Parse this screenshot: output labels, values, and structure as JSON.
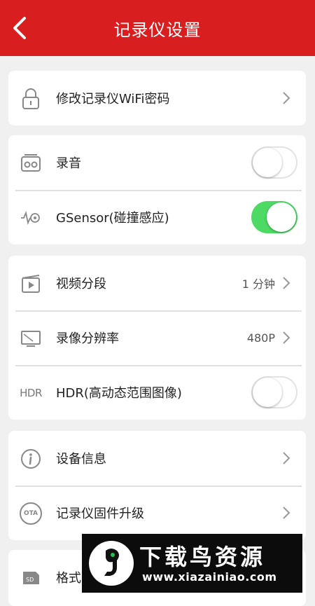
{
  "header": {
    "title": "记录仪设置"
  },
  "colors": {
    "accent": "#d81e1e",
    "toggle_on": "#4cd964"
  },
  "sections": {
    "wifi": {
      "label": "修改记录仪WiFi密码",
      "icon": "lock-icon"
    },
    "audio": {
      "label": "录音",
      "icon": "recorder-icon",
      "toggle": "off"
    },
    "gsensor": {
      "label": "GSensor(碰撞感应)",
      "icon": "vibration-sensor-icon",
      "toggle": "on"
    },
    "video_segment": {
      "label": "视频分段",
      "value": "1 分钟",
      "icon": "film-icon"
    },
    "resolution": {
      "label": "录像分辨率",
      "value": "480P",
      "icon": "monitor-icon"
    },
    "hdr": {
      "label": "HDR(高动态范围图像)",
      "icon_text": "HDR",
      "toggle": "off"
    },
    "device_info": {
      "label": "设备信息",
      "icon": "info-icon"
    },
    "firmware": {
      "label": "记录仪固件升级",
      "icon_text": "OTA"
    },
    "format": {
      "label": "格式",
      "icon": "sd-card-icon"
    }
  },
  "watermark": {
    "title": "下载鸟资源",
    "url": "www.xiazainiao.com"
  }
}
